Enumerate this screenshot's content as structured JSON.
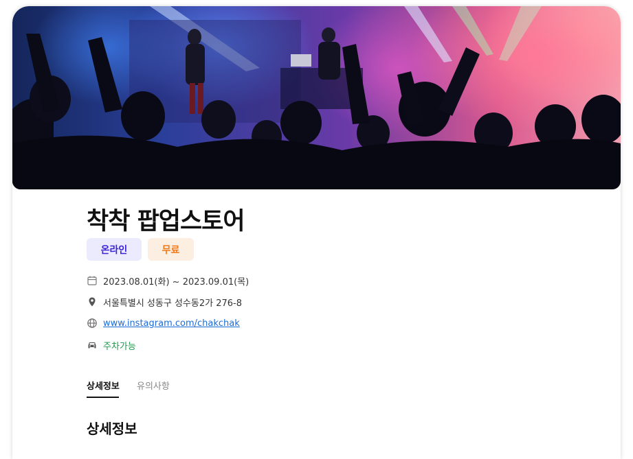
{
  "event": {
    "title": "착착 팝업스토어",
    "badges": {
      "online": "온라인",
      "free": "무료"
    },
    "date": "2023.08.01(화) ~ 2023.09.01(목)",
    "address": "서울특별시 성동구 성수동2가 276-8",
    "website": "www.instagram.com/chakchak",
    "parking": "주차가능"
  },
  "tabs": {
    "detail": "상세정보",
    "notice": "유의사항"
  },
  "section": {
    "title": "상세정보"
  },
  "icons": [
    "calendar-icon",
    "location-pin-icon",
    "globe-icon",
    "car-icon"
  ],
  "colors": {
    "online_badge_bg": "#ecebfd",
    "online_badge_text": "#3a25d6",
    "free_badge_bg": "#fdeee2",
    "free_badge_text": "#f07a18",
    "link": "#1a6cd8",
    "parking": "#1d9a4a"
  }
}
